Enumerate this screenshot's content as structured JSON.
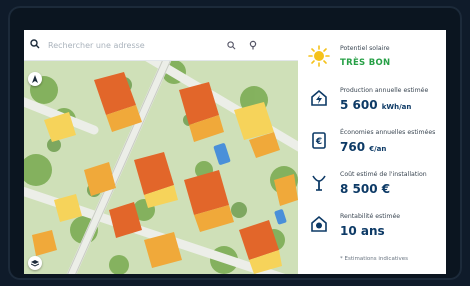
{
  "search": {
    "placeholder": "Rechercher une adresse",
    "search_icon": "search-icon",
    "tool_icons": [
      "zoom-icon",
      "locate-icon"
    ]
  },
  "map": {
    "controls": [
      "north-icon",
      "layers-icon"
    ],
    "colors": {
      "ground": "#d8e7c8",
      "trees": "#6fa24a",
      "road": "#e9ece6",
      "roof_high": "#e2662a",
      "roof_mid": "#f0a93a",
      "roof_low": "#f6d35a",
      "pool": "#4a90d9"
    }
  },
  "panel": {
    "rows": [
      {
        "icon": "sun-icon",
        "label": "Potentiel solaire",
        "value": "TRÈS BON",
        "style": "green"
      },
      {
        "icon": "house-bolt-icon",
        "label": "Production annuelle estimée",
        "value": "5 600",
        "unit": "kWh/an"
      },
      {
        "icon": "euro-doc-icon",
        "label": "Économies annuelles estimées",
        "value": "760",
        "unit": "€/an"
      },
      {
        "icon": "bolt-tower-icon",
        "label": "Coût estimé de l'installation",
        "value": "8 500 €",
        "unit": ""
      },
      {
        "icon": "house-check-icon",
        "label": "Rentabilité estimée",
        "value": "10 ans",
        "unit": ""
      }
    ],
    "note": "* Estimations indicatives"
  },
  "accent": {
    "navy": "#0d3a66",
    "green": "#27a046",
    "sun": "#f5c21b"
  }
}
